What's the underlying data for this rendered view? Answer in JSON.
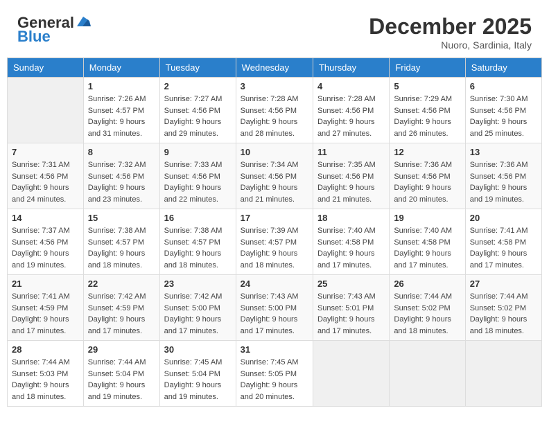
{
  "header": {
    "logo_line1": "General",
    "logo_line2": "Blue",
    "month": "December 2025",
    "location": "Nuoro, Sardinia, Italy"
  },
  "days_of_week": [
    "Sunday",
    "Monday",
    "Tuesday",
    "Wednesday",
    "Thursday",
    "Friday",
    "Saturday"
  ],
  "weeks": [
    [
      {
        "day": "",
        "info": ""
      },
      {
        "day": "1",
        "sunrise": "7:26 AM",
        "sunset": "4:57 PM",
        "daylight": "9 hours and 31 minutes."
      },
      {
        "day": "2",
        "sunrise": "7:27 AM",
        "sunset": "4:56 PM",
        "daylight": "9 hours and 29 minutes."
      },
      {
        "day": "3",
        "sunrise": "7:28 AM",
        "sunset": "4:56 PM",
        "daylight": "9 hours and 28 minutes."
      },
      {
        "day": "4",
        "sunrise": "7:28 AM",
        "sunset": "4:56 PM",
        "daylight": "9 hours and 27 minutes."
      },
      {
        "day": "5",
        "sunrise": "7:29 AM",
        "sunset": "4:56 PM",
        "daylight": "9 hours and 26 minutes."
      },
      {
        "day": "6",
        "sunrise": "7:30 AM",
        "sunset": "4:56 PM",
        "daylight": "9 hours and 25 minutes."
      }
    ],
    [
      {
        "day": "7",
        "sunrise": "7:31 AM",
        "sunset": "4:56 PM",
        "daylight": "9 hours and 24 minutes."
      },
      {
        "day": "8",
        "sunrise": "7:32 AM",
        "sunset": "4:56 PM",
        "daylight": "9 hours and 23 minutes."
      },
      {
        "day": "9",
        "sunrise": "7:33 AM",
        "sunset": "4:56 PM",
        "daylight": "9 hours and 22 minutes."
      },
      {
        "day": "10",
        "sunrise": "7:34 AM",
        "sunset": "4:56 PM",
        "daylight": "9 hours and 21 minutes."
      },
      {
        "day": "11",
        "sunrise": "7:35 AM",
        "sunset": "4:56 PM",
        "daylight": "9 hours and 21 minutes."
      },
      {
        "day": "12",
        "sunrise": "7:36 AM",
        "sunset": "4:56 PM",
        "daylight": "9 hours and 20 minutes."
      },
      {
        "day": "13",
        "sunrise": "7:36 AM",
        "sunset": "4:56 PM",
        "daylight": "9 hours and 19 minutes."
      }
    ],
    [
      {
        "day": "14",
        "sunrise": "7:37 AM",
        "sunset": "4:56 PM",
        "daylight": "9 hours and 19 minutes."
      },
      {
        "day": "15",
        "sunrise": "7:38 AM",
        "sunset": "4:57 PM",
        "daylight": "9 hours and 18 minutes."
      },
      {
        "day": "16",
        "sunrise": "7:38 AM",
        "sunset": "4:57 PM",
        "daylight": "9 hours and 18 minutes."
      },
      {
        "day": "17",
        "sunrise": "7:39 AM",
        "sunset": "4:57 PM",
        "daylight": "9 hours and 18 minutes."
      },
      {
        "day": "18",
        "sunrise": "7:40 AM",
        "sunset": "4:58 PM",
        "daylight": "9 hours and 17 minutes."
      },
      {
        "day": "19",
        "sunrise": "7:40 AM",
        "sunset": "4:58 PM",
        "daylight": "9 hours and 17 minutes."
      },
      {
        "day": "20",
        "sunrise": "7:41 AM",
        "sunset": "4:58 PM",
        "daylight": "9 hours and 17 minutes."
      }
    ],
    [
      {
        "day": "21",
        "sunrise": "7:41 AM",
        "sunset": "4:59 PM",
        "daylight": "9 hours and 17 minutes."
      },
      {
        "day": "22",
        "sunrise": "7:42 AM",
        "sunset": "4:59 PM",
        "daylight": "9 hours and 17 minutes."
      },
      {
        "day": "23",
        "sunrise": "7:42 AM",
        "sunset": "5:00 PM",
        "daylight": "9 hours and 17 minutes."
      },
      {
        "day": "24",
        "sunrise": "7:43 AM",
        "sunset": "5:00 PM",
        "daylight": "9 hours and 17 minutes."
      },
      {
        "day": "25",
        "sunrise": "7:43 AM",
        "sunset": "5:01 PM",
        "daylight": "9 hours and 17 minutes."
      },
      {
        "day": "26",
        "sunrise": "7:44 AM",
        "sunset": "5:02 PM",
        "daylight": "9 hours and 18 minutes."
      },
      {
        "day": "27",
        "sunrise": "7:44 AM",
        "sunset": "5:02 PM",
        "daylight": "9 hours and 18 minutes."
      }
    ],
    [
      {
        "day": "28",
        "sunrise": "7:44 AM",
        "sunset": "5:03 PM",
        "daylight": "9 hours and 18 minutes."
      },
      {
        "day": "29",
        "sunrise": "7:44 AM",
        "sunset": "5:04 PM",
        "daylight": "9 hours and 19 minutes."
      },
      {
        "day": "30",
        "sunrise": "7:45 AM",
        "sunset": "5:04 PM",
        "daylight": "9 hours and 19 minutes."
      },
      {
        "day": "31",
        "sunrise": "7:45 AM",
        "sunset": "5:05 PM",
        "daylight": "9 hours and 20 minutes."
      },
      {
        "day": "",
        "info": ""
      },
      {
        "day": "",
        "info": ""
      },
      {
        "day": "",
        "info": ""
      }
    ]
  ]
}
